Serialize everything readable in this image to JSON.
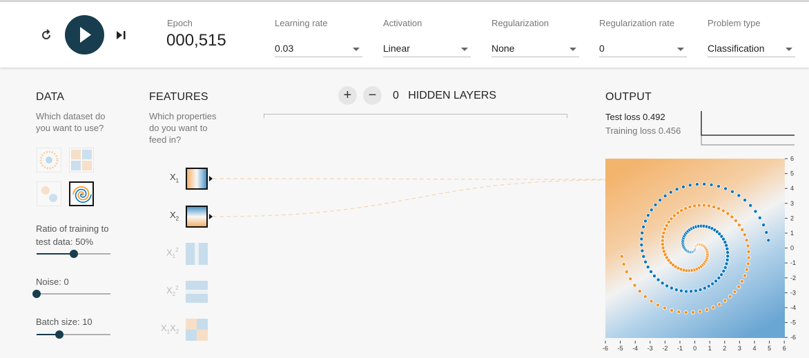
{
  "header": {
    "epoch_label": "Epoch",
    "epoch_value": "000,515",
    "controls": [
      {
        "label": "Learning rate",
        "value": "0.03"
      },
      {
        "label": "Activation",
        "value": "Linear"
      },
      {
        "label": "Regularization",
        "value": "None"
      },
      {
        "label": "Regularization rate",
        "value": "0"
      },
      {
        "label": "Problem type",
        "value": "Classification"
      }
    ]
  },
  "data": {
    "title": "DATA",
    "subtitle_1": "Which dataset do",
    "subtitle_2": "you want to use?",
    "ratio_label_1": "Ratio of training to",
    "ratio_label_2": "test data:  50%",
    "ratio": 0.5,
    "noise_label": "Noise:  0",
    "noise": 0,
    "batch_label": "Batch size:  10",
    "batch": 10
  },
  "features": {
    "title": "FEATURES",
    "subtitle_1": "Which properties",
    "subtitle_2": "do you want to",
    "subtitle_3": "feed in?"
  },
  "layers": {
    "plus": "+",
    "minus": "−",
    "count": "0",
    "label": "HIDDEN LAYERS"
  },
  "output": {
    "title": "OUTPUT",
    "test_loss": "Test loss 0.492",
    "training_loss": "Training loss 0.456",
    "ticks": [
      "6",
      "5",
      "4",
      "3",
      "2",
      "1",
      "0",
      "-1",
      "-2",
      "-3",
      "-4",
      "-5",
      "-6"
    ],
    "xticks": [
      "-6",
      "-5",
      "-4",
      "-3",
      "-2",
      "-1",
      "0",
      "1",
      "2",
      "3",
      "4",
      "5",
      "6"
    ]
  },
  "colors": {
    "orange": "#f59322",
    "blue": "#0877bd",
    "dark": "#183d4e"
  }
}
